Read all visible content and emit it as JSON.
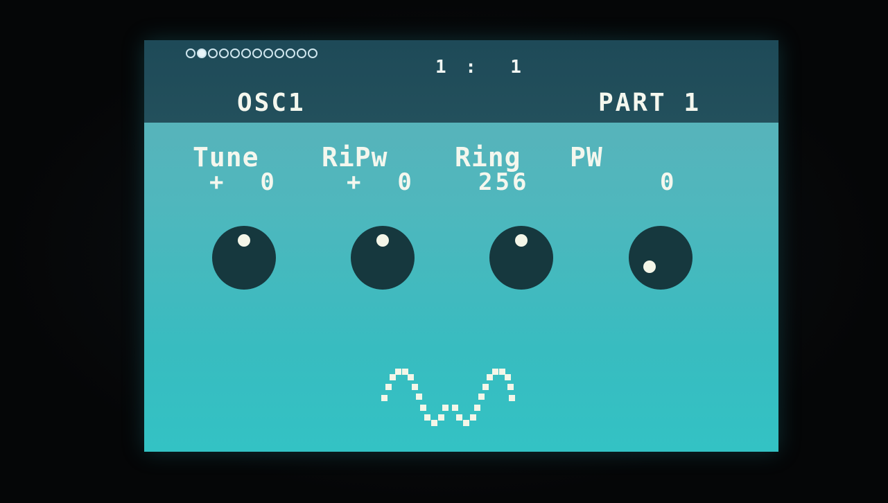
{
  "header": {
    "page_count": 12,
    "active_page_index": 1,
    "counter": "1 :  1",
    "module_title": "OSC1",
    "part_title": "PART 1"
  },
  "params": [
    {
      "label": "Tune",
      "value": "+  0"
    },
    {
      "label": "RiPw",
      "value": "+  0"
    },
    {
      "label": "Ring",
      "value": "256"
    },
    {
      "label": "PW",
      "value": "0"
    }
  ],
  "knobs": [
    {
      "name": "tune-knob",
      "indicator": "top"
    },
    {
      "name": "ripw-knob",
      "indicator": "top"
    },
    {
      "name": "ring-knob",
      "indicator": "top"
    },
    {
      "name": "pw-knob",
      "indicator": "bottom-left"
    }
  ],
  "waveform": {
    "shape": "sine",
    "icon": "sine-wave-icon"
  },
  "colors": {
    "screen_bg": "#44b8bc",
    "header_bg": "#21505c",
    "knob": "#16383e",
    "text": "#f4f7ee"
  }
}
